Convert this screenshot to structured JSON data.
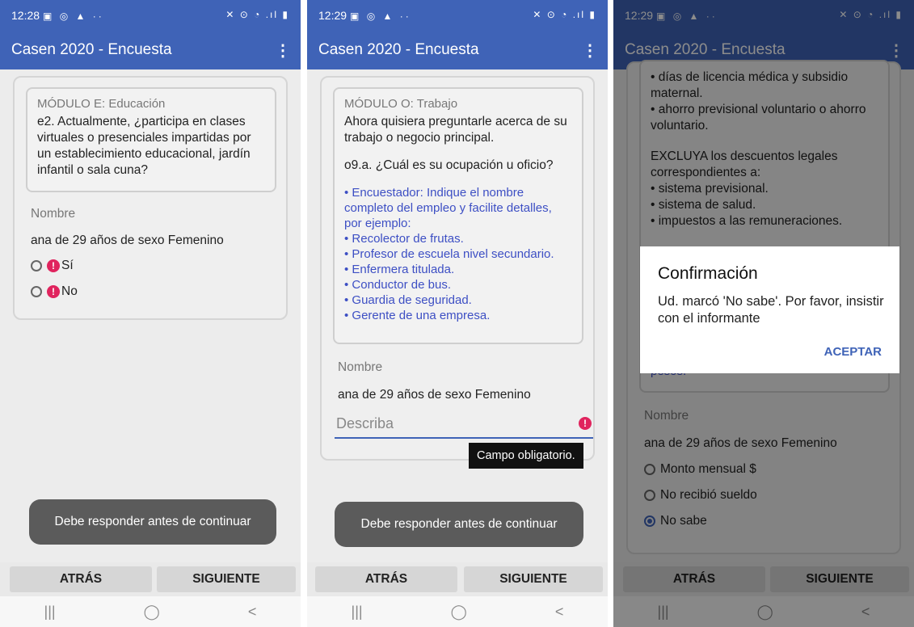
{
  "screens": [
    {
      "status": {
        "time": "12:28",
        "icons": "▣ ◎ ▲ ··",
        "right_icons": "✕ ⊙ ◔ .ıl ▮"
      },
      "app": {
        "title": "Casen 2020 - Encuesta",
        "menu": "⋮"
      },
      "question": {
        "module": "MÓDULO E: Educación",
        "text": "e2. Actualmente, ¿participa en clases virtuales o presenciales impartidas por un establecimiento educacional, jardín infantil o sala cuna?"
      },
      "name_label": "Nombre",
      "person": "ana de 29 años de sexo Femenino",
      "options": [
        "Sí",
        "No"
      ],
      "toast": "Debe responder antes de continuar",
      "back": "ATRÁS",
      "next": "SIGUIENTE"
    },
    {
      "status": {
        "time": "12:29",
        "icons": "▣ ◎ ▲ ··",
        "right_icons": "✕ ⊙ ◔ .ıl ▮"
      },
      "app": {
        "title": "Casen 2020 - Encuesta",
        "menu": "⋮"
      },
      "question": {
        "module": "MÓDULO O: Trabajo",
        "intro": "Ahora quisiera preguntarle acerca de su trabajo o negocio principal.",
        "text": "o9.a. ¿Cuál es su ocupación u oficio?",
        "hint": [
          "• Encuestador: Indique el nombre completo del empleo y facilite detalles, por ejemplo:",
          "• Recolector de frutas.",
          "• Profesor de escuela nivel secundario.",
          "• Enfermera titulada.",
          "• Conductor de bus.",
          "• Guardia de seguridad.",
          "• Gerente de una empresa."
        ]
      },
      "name_label": "Nombre",
      "person": "ana de 29 años de sexo Femenino",
      "input_placeholder": "Describa",
      "tooltip": "Campo obligatorio.",
      "toast": "Debe responder antes de continuar",
      "back": "ATRÁS",
      "next": "SIGUIENTE"
    },
    {
      "status": {
        "time": "12:29",
        "icons": "▣ ◎ ▲ ··",
        "right_icons": "✕ ⊙ ◔ .ıl ▮"
      },
      "app": {
        "title": "Casen 2020 - Encuesta",
        "menu": "⋮"
      },
      "question_lines": [
        "• días de licencia médica y subsidio maternal.",
        "• ahorro previsional voluntario o ahorro voluntario.",
        "",
        "EXCLUYA los descuentos legales correspondientes a:",
        "• sistema previsional.",
        "• sistema de salud.",
        "• impuestos a las remuneraciones."
      ],
      "trailing_hint": "pesos.",
      "name_label": "Nombre",
      "person": "ana de 29 años de sexo Femenino",
      "options": [
        "Monto mensual $",
        "No recibió sueldo",
        "No sabe"
      ],
      "selected_option": "No sabe",
      "dialog": {
        "title": "Confirmación",
        "message": "Ud. marcó 'No sabe'. Por favor, insistir con el informante",
        "accept": "ACEPTAR"
      },
      "back": "ATRÁS",
      "next": "SIGUIENTE"
    }
  ],
  "nav": {
    "recent": "|||",
    "home": "◯",
    "back": "<"
  },
  "colors": {
    "accent": "#3f63b7",
    "error": "#e0245e",
    "hint": "#3d4fc4"
  }
}
